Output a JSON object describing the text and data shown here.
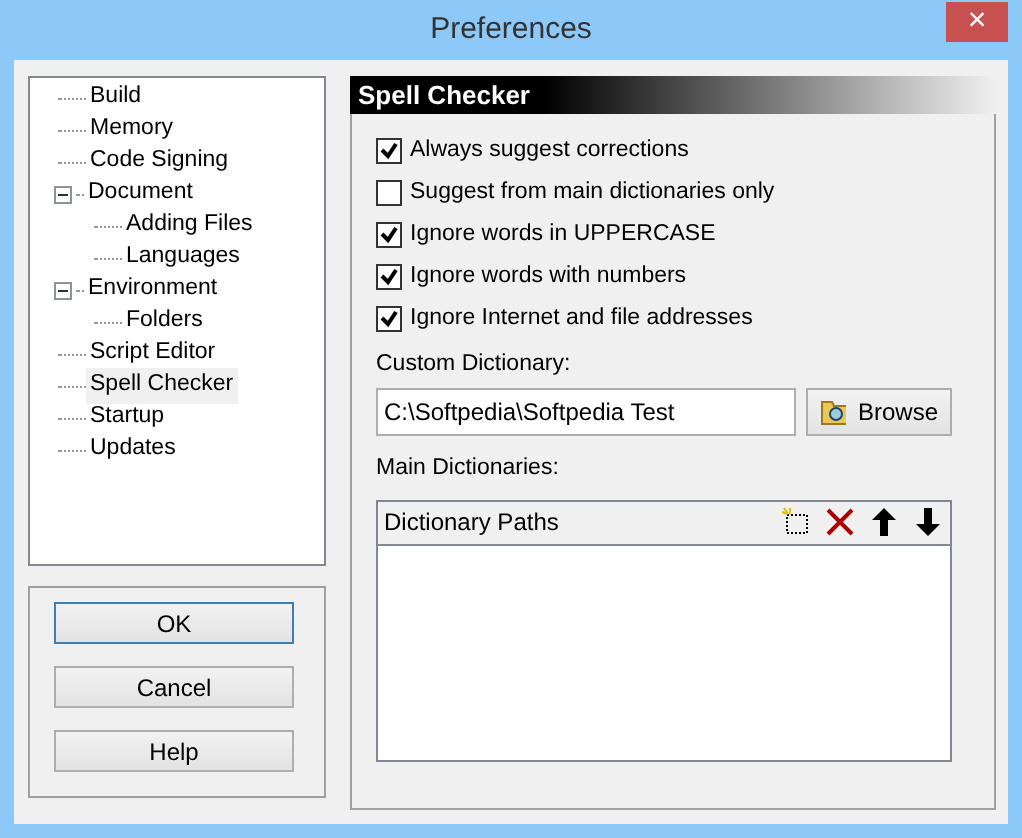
{
  "window": {
    "title": "Preferences",
    "close": "×"
  },
  "tree": [
    {
      "label": "Build",
      "selected": false
    },
    {
      "label": "Memory",
      "selected": false
    },
    {
      "label": "Code Signing",
      "selected": false
    },
    {
      "label": "Document",
      "selected": false,
      "expanded": true,
      "children": [
        {
          "label": "Adding Files",
          "selected": false
        },
        {
          "label": "Languages",
          "selected": false
        }
      ]
    },
    {
      "label": "Environment",
      "selected": false,
      "expanded": true,
      "children": [
        {
          "label": "Folders",
          "selected": false
        }
      ]
    },
    {
      "label": "Script Editor",
      "selected": false
    },
    {
      "label": "Spell Checker",
      "selected": true
    },
    {
      "label": "Startup",
      "selected": false
    },
    {
      "label": "Updates",
      "selected": false
    }
  ],
  "buttons": [
    {
      "label": "OK",
      "default": true
    },
    {
      "label": "Cancel",
      "default": false
    },
    {
      "label": "Help",
      "default": false
    }
  ],
  "panel": {
    "title": "Spell Checker",
    "options": [
      {
        "label": "Always suggest corrections",
        "checked": true
      },
      {
        "label": "Suggest from main dictionaries only",
        "checked": false
      },
      {
        "label": "Ignore words in UPPERCASE",
        "checked": true
      },
      {
        "label": "Ignore words with numbers",
        "checked": true
      },
      {
        "label": "Ignore Internet and file addresses",
        "checked": true
      }
    ],
    "custom_dictionary": {
      "label": "Custom Dictionary:",
      "value": "C:\\Softpedia\\Softpedia Test",
      "button": "Browse"
    },
    "main_dictionaries": {
      "label": "Main Dictionaries:",
      "column": "Dictionary Paths"
    }
  }
}
